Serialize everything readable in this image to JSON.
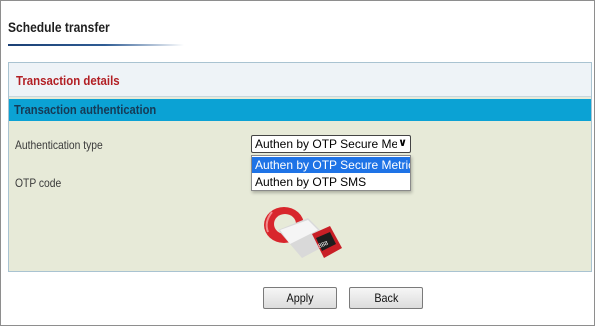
{
  "page": {
    "title": "Schedule transfer"
  },
  "details": {
    "header": "Transaction details"
  },
  "authentication": {
    "header": "Transaction authentication",
    "type_label": "Authentication type",
    "otp_label": "OTP code",
    "select": {
      "value": "Authen by OTP Secure Metric",
      "options": [
        {
          "label": "Authen by OTP Secure Metric",
          "selected": true
        },
        {
          "label": "Authen by OTP SMS",
          "selected": false
        }
      ]
    },
    "token_icon": "otp-token-device-icon"
  },
  "buttons": {
    "apply": "Apply",
    "back": "Back"
  },
  "colors": {
    "section_header_text": "#b21f24",
    "auth_header_bg": "#0ba2d4",
    "panel_bg": "#e7ead8",
    "selected_option_bg": "#1e73e6"
  }
}
